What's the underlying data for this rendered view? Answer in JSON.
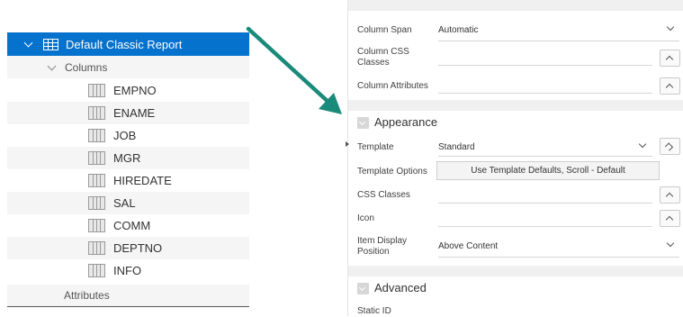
{
  "tree": {
    "report_label": "Default Classic Report",
    "columns_label": "Columns",
    "columns": [
      "EMPNO",
      "ENAME",
      "JOB",
      "MGR",
      "HIREDATE",
      "SAL",
      "COMM",
      "DEPTNO",
      "INFO"
    ],
    "attributes_label": "Attributes"
  },
  "panel": {
    "column_span_label": "Column Span",
    "column_span_value": "Automatic",
    "column_css_classes_label": "Column CSS Classes",
    "column_attributes_label": "Column Attributes",
    "appearance_title": "Appearance",
    "template_label": "Template",
    "template_value": "Standard",
    "template_options_label": "Template Options",
    "template_options_value": "Use Template Defaults, Scroll - Default",
    "css_classes_label": "CSS Classes",
    "icon_label": "Icon",
    "item_display_position_label": "Item Display Position",
    "item_display_position_value": "Above Content",
    "advanced_title": "Advanced",
    "static_id_label": "Static ID"
  },
  "colors": {
    "selected": "#0572ce",
    "arrow": "#1a8a7a"
  }
}
